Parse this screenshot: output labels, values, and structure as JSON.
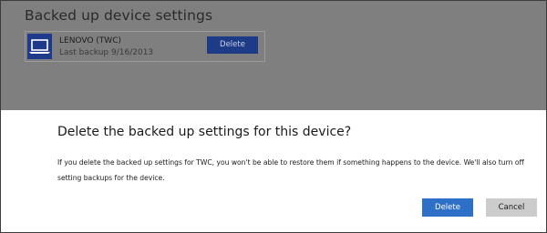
{
  "background_page": {
    "title": "Backed up device settings",
    "device": {
      "icon": "laptop-icon",
      "name": "LENOVO (TWC)",
      "last_backup": "Last backup 9/16/2013",
      "delete_label": "Delete"
    }
  },
  "dialog": {
    "title": "Delete the backed up settings for this device?",
    "message": "If you delete the backed up settings for TWC, you won't be able to restore them if something happens to the device. We'll also turn off setting backups for the device.",
    "buttons": {
      "delete_label": "Delete",
      "cancel_label": "Cancel"
    }
  },
  "colors": {
    "overlay": "#7f7f7f",
    "tile_icon": "#1e3a8a",
    "tile_button": "#1d3b86",
    "dialog_primary": "#2e6fc8",
    "dialog_secondary": "#cccccc"
  }
}
